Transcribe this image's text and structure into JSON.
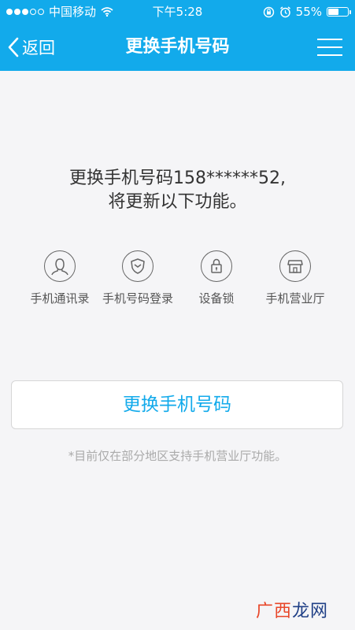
{
  "status_bar": {
    "carrier": "中国移动",
    "time": "下午5:28",
    "battery_text": "55%",
    "battery_level": 0.55,
    "icons": [
      "signal-dots",
      "wifi-icon",
      "rotation-lock-icon",
      "alarm-icon",
      "battery-icon"
    ]
  },
  "nav": {
    "back_label": "返回",
    "title": "更换手机号码",
    "icons": [
      "chevron-left-icon",
      "menu-icon"
    ]
  },
  "message": {
    "line1": "更换手机号码158******52,",
    "line2": "将更新以下功能。"
  },
  "features": [
    {
      "label": "手机通讯录",
      "icon": "contact-icon"
    },
    {
      "label": "手机号码登录",
      "icon": "shield-icon"
    },
    {
      "label": "设备锁",
      "icon": "lock-icon"
    },
    {
      "label": "手机营业厅",
      "icon": "store-icon"
    }
  ],
  "cta": {
    "label": "更换手机号码"
  },
  "note": "*目前仅在部分地区支持手机营业厅功能。",
  "watermark": {
    "part1": "广西",
    "part2": "龙网"
  },
  "colors": {
    "accent": "#12aaeb",
    "background": "#f5f5f7",
    "watermark_1": "#e8472a",
    "watermark_2": "#1f3f86"
  }
}
